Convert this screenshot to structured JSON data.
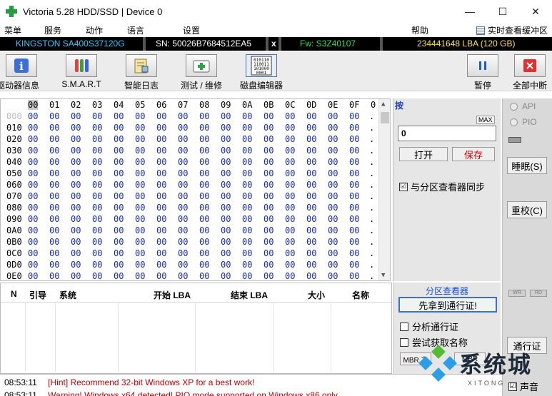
{
  "window": {
    "title": "Victoria 5.28 HDD/SSD | Device 0",
    "minimize": "—",
    "maximize": "☐",
    "close": "✕"
  },
  "menu": {
    "items": [
      "菜单",
      "服务",
      "动作",
      "语言",
      "设置",
      "帮助"
    ],
    "live_help": "实时查看缓冲区"
  },
  "device": {
    "model": "KINGSTON SA400S37120G",
    "serial": "SN: 50026B7684512EA5",
    "close": "x",
    "firmware": "Fw: S3Z40107",
    "capacity": "234441648 LBA (120 GB)"
  },
  "toolbar": {
    "buttons": [
      {
        "label": "驱动器信息",
        "icon": "info-icon"
      },
      {
        "label": "S.M.A.R.T",
        "icon": "test-tubes-icon"
      },
      {
        "label": "智能日志",
        "icon": "log-icon"
      },
      {
        "label": "测试 / 维修",
        "icon": "medkit-icon"
      },
      {
        "label": "磁盘编辑器",
        "icon": "binary-icon"
      }
    ],
    "pause": "暂停",
    "abort_all": "全部中断"
  },
  "hex_editor": {
    "columns": [
      "0",
      "0",
      "0 1",
      "0 2",
      "0 3",
      "0 4",
      "0 5",
      "0 6",
      "0 7",
      "0 8",
      "0 9",
      "0 A",
      "0 B",
      "0 C",
      "0 D",
      "0 E",
      "0 F",
      "0"
    ],
    "col_labels": [
      "00",
      "01",
      "02",
      "03",
      "04",
      "05",
      "06",
      "07",
      "08",
      "09",
      "0A",
      "0B",
      "0C",
      "0D",
      "0E",
      "0F",
      "0"
    ],
    "rows": [
      "000",
      "010",
      "020",
      "030",
      "040",
      "050",
      "060",
      "070",
      "080",
      "090",
      "0A0",
      "0B0",
      "0C0",
      "0D0",
      "0E0"
    ],
    "byte_value": "00",
    "trail": "."
  },
  "editor_controls": {
    "header": "按",
    "max_label": "MAX",
    "sector_value": "0",
    "open": "打开",
    "save": "保存",
    "sync_label": "与分区查看器同步",
    "sync_checked": "☑"
  },
  "side": {
    "api": "API",
    "pio": "PIO",
    "sleep": "睡眠(S)",
    "recalibrate": "重校(C)",
    "wr": "WR",
    "rd": "RD",
    "passport": "通行证",
    "sound": "声音",
    "sound_check": "☑"
  },
  "partition_table": {
    "headers": [
      "N",
      "引导",
      "系统",
      "开始 LBA",
      "结束 LBA",
      "大小",
      "名称"
    ]
  },
  "partition_viewer": {
    "title": "分区查看器",
    "get_passport": "先拿到通行证!",
    "analyze_passport": "分析通行证",
    "try_get_name": "尝试获取名称",
    "mbr_1": "MBR 主",
    "mbr_2": "MBR"
  },
  "log": {
    "lines": [
      {
        "time": "08:53:11",
        "text": "[Hint] Recommend 32-bit Windows XP for a best work!",
        "color": "#c00000"
      },
      {
        "time": "08:53:11",
        "text": "Warning! Windows x64 detected! PIO mode supported on Windows x86 only.",
        "color": "#c00000"
      }
    ]
  },
  "watermark": {
    "brand": "系统城",
    "sub": "XITONG"
  },
  "colors": {
    "device_model": "#33ccff",
    "serial": "#ffffff",
    "firmware": "#33dd55",
    "capacity": "#ffe340",
    "hex_blue": "#1a2ab5",
    "save_red": "#d00000",
    "link_blue": "#1a4fd0"
  }
}
